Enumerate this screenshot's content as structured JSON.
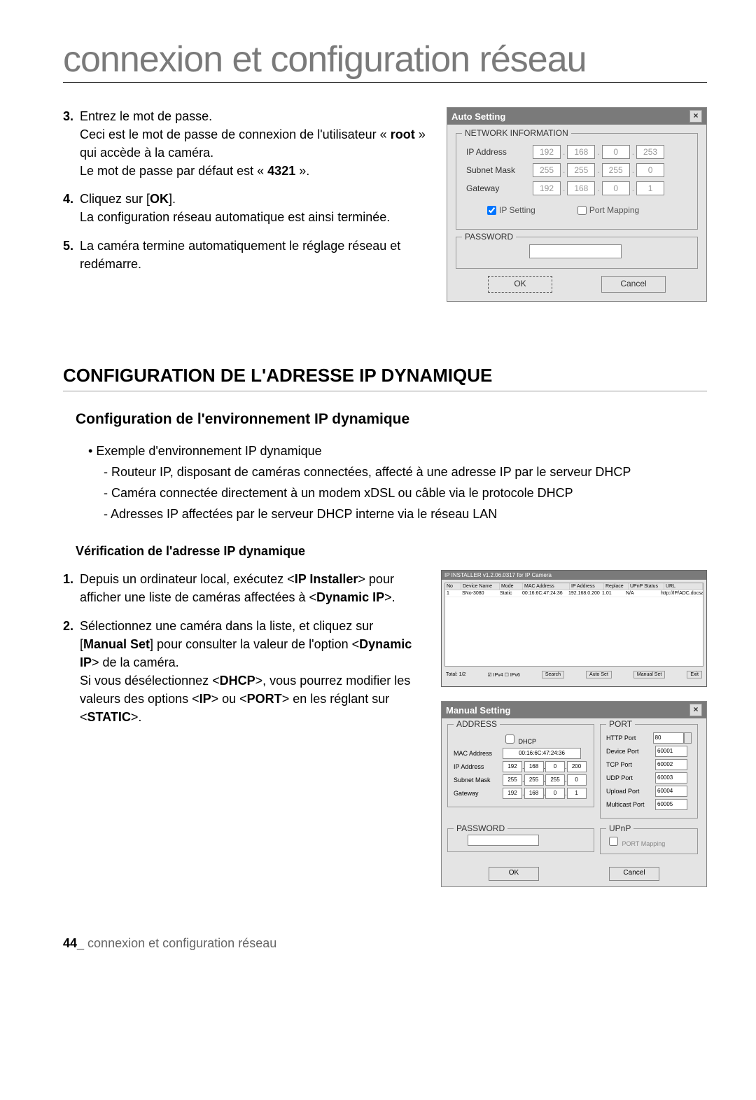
{
  "page_title": "connexion et configuration réseau",
  "steps_a": {
    "3": {
      "line1": "Entrez le mot de passe.",
      "line2": "Ceci est le mot de passe de connexion de l'utilisateur « ",
      "root": "root",
      "line2b": " » qui accède à la caméra.",
      "line3": "Le mot de passe par défaut est « ",
      "pw": "4321",
      "line3b": " »."
    },
    "4": {
      "line1a": "Cliquez sur [",
      "ok": "OK",
      "line1b": "].",
      "line2": "La configuration réseau automatique est ainsi terminée."
    },
    "5": "La caméra termine automatiquement le réglage réseau et redémarre."
  },
  "auto_dialog": {
    "title": "Auto Setting",
    "network_info": "NETWORK INFORMATION",
    "ip_label": "IP Address",
    "ip": [
      "192",
      "168",
      "0",
      "253"
    ],
    "subnet_label": "Subnet Mask",
    "subnet": [
      "255",
      "255",
      "255",
      "0"
    ],
    "gateway_label": "Gateway",
    "gateway": [
      "192",
      "168",
      "0",
      "1"
    ],
    "ip_setting": "IP Setting",
    "port_mapping": "Port Mapping",
    "password": "PASSWORD",
    "ok": "OK",
    "cancel": "Cancel"
  },
  "section_head": "CONFIGURATION DE L'ADRESSE IP DYNAMIQUE",
  "sub_head": "Configuration de l'environnement IP dynamique",
  "bullet_lead": "Exemple d'environnement IP dynamique",
  "dash1": "Routeur IP, disposant de caméras connectées, affecté à une adresse IP par le serveur DHCP",
  "dash2": "Caméra connectée directement à un modem xDSL ou câble via le protocole DHCP",
  "dash3": "Adresses IP affectées par le serveur DHCP interne via le réseau LAN",
  "smallhead": "Vérification de l'adresse IP dynamique",
  "steps_b": {
    "1": {
      "a": "Depuis un ordinateur local, exécutez <",
      "b": "IP Installer",
      "c": "> pour afficher une liste de caméras affectées à <",
      "d": "Dynamic IP",
      "e": ">."
    },
    "2": {
      "a": "Sélectionnez une caméra dans la liste, et cliquez sur [",
      "b": "Manual Set",
      "c": "] pour consulter la valeur de l'option <",
      "d": "Dynamic IP",
      "e": "> de la caméra.",
      "f": "Si vous désélectionnez <",
      "g": "DHCP",
      "h": ">, vous pourrez modifier les valeurs des options <",
      "i": "IP",
      "j": "> ou <",
      "k": "PORT",
      "l": "> en les réglant sur <",
      "m": "STATIC",
      "n": ">."
    }
  },
  "installer": {
    "title": "IP INSTALLER v1.2.06.0317 for IP Camera",
    "headers": [
      "No",
      "Device Name",
      "Mode",
      "MAC Address",
      "IP Address",
      "Replace",
      "UPnP Status",
      "URL"
    ],
    "row": [
      "1",
      "SNo-3080",
      "Static",
      "00:16:6C:47:24:36",
      "192.168.0.200",
      "1.01",
      "N/A",
      "http://IP/ADC.docsamsung.ipol..."
    ],
    "total": "Total: 1/2",
    "ipv4": "IPv4",
    "ipv6": "IPv6",
    "search": "Search",
    "autoset": "Auto Set",
    "manualset": "Manual Set",
    "exit": "Exit"
  },
  "manual_dialog": {
    "title": "Manual Setting",
    "address": "ADDRESS",
    "dhcp": "DHCP",
    "mac_label": "MAC Address",
    "mac": "00:16:6C:47:24:36",
    "ip_label": "IP Address",
    "ip": [
      "192",
      "168",
      "0",
      "200"
    ],
    "subnet_label": "Subnet Mask",
    "subnet": [
      "255",
      "255",
      "255",
      "0"
    ],
    "gateway_label": "Gateway",
    "gateway": [
      "192",
      "168",
      "0",
      "1"
    ],
    "port": "PORT",
    "http_port": "HTTP Port",
    "http_val": "80",
    "device_port": "Device Port",
    "device_val": "60001",
    "tcp_port": "TCP Port",
    "tcp_val": "60002",
    "udp_port": "UDP Port",
    "udp_val": "60003",
    "upload_port": "Upload Port",
    "upload_val": "60004",
    "multicast_port": "Multicast Port",
    "multicast_val": "60005",
    "password": "PASSWORD",
    "upnp": "UPnP",
    "port_mapping": "PORT Mapping",
    "ok": "OK",
    "cancel": "Cancel"
  },
  "footer_num": "44",
  "footer_text": "_ connexion et configuration réseau"
}
